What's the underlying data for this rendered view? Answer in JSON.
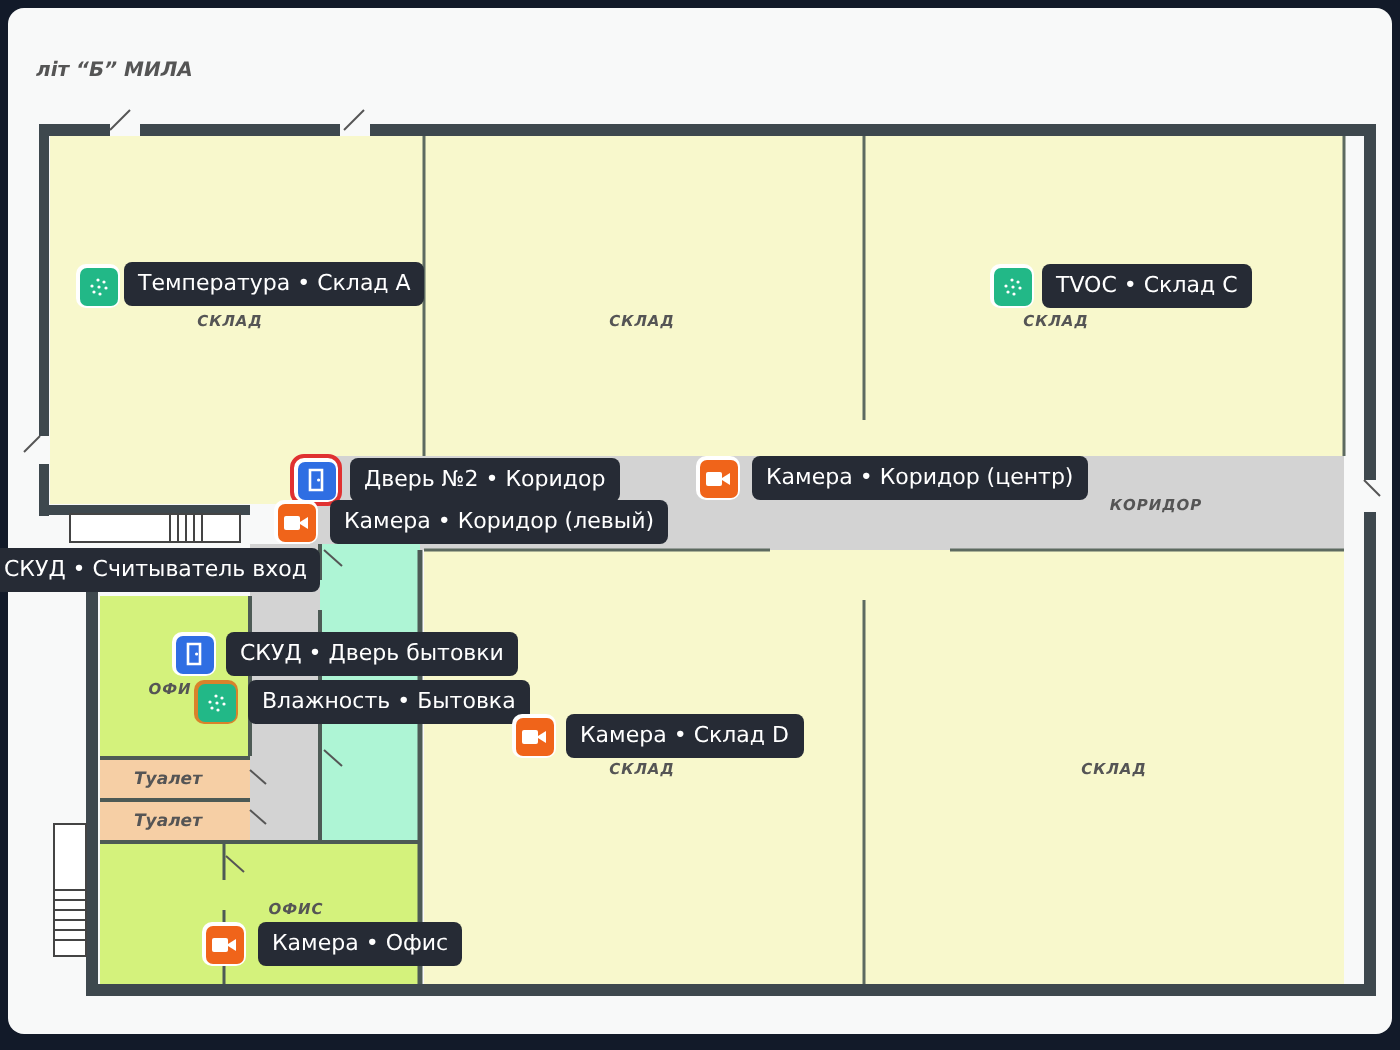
{
  "plan_title": "літ “Б” МИЛА",
  "rooms": [
    {
      "kind": "storage",
      "label": "СКЛАД"
    },
    {
      "kind": "storage",
      "label": "СКЛАД"
    },
    {
      "kind": "storage",
      "label": "СКЛАД"
    },
    {
      "kind": "corridor",
      "label": "КОРИДОР"
    },
    {
      "kind": "corridor"
    },
    {
      "kind": "utility"
    },
    {
      "kind": "office",
      "label": "ОФИ"
    },
    {
      "kind": "toilet",
      "label": "Туалет"
    },
    {
      "kind": "toilet",
      "label": "Туалет"
    },
    {
      "kind": "storage",
      "label": "СКЛАД"
    },
    {
      "kind": "storage",
      "label": "СКЛАД"
    },
    {
      "kind": "office",
      "label": "ОФИС"
    }
  ],
  "markers": [
    {
      "kind": "sensor",
      "label": "Температура • Склад A",
      "selected": false,
      "alert": false
    },
    {
      "kind": "sensor",
      "label": "TVOC • Склад C",
      "selected": false,
      "alert": false
    },
    {
      "kind": "door",
      "label": "Дверь №2 • Коридор",
      "selected": true,
      "alert": false
    },
    {
      "kind": "camera",
      "label": "Камера • Коридор (центр)",
      "selected": false,
      "alert": false
    },
    {
      "kind": "camera",
      "label": "Камера • Коридор (левый)",
      "selected": false,
      "alert": false
    },
    {
      "label": "СКУД • Считыватель вход"
    },
    {
      "kind": "door",
      "label": "СКУД • Дверь бытовки",
      "selected": false,
      "alert": false
    },
    {
      "kind": "sensor",
      "label": "Влажность • Бытовка",
      "selected": false,
      "alert": true
    },
    {
      "kind": "camera",
      "label": "Камера • Склад D",
      "selected": false,
      "alert": false
    },
    {
      "kind": "camera",
      "label": "Камера • Офис",
      "selected": false,
      "alert": false
    }
  ]
}
